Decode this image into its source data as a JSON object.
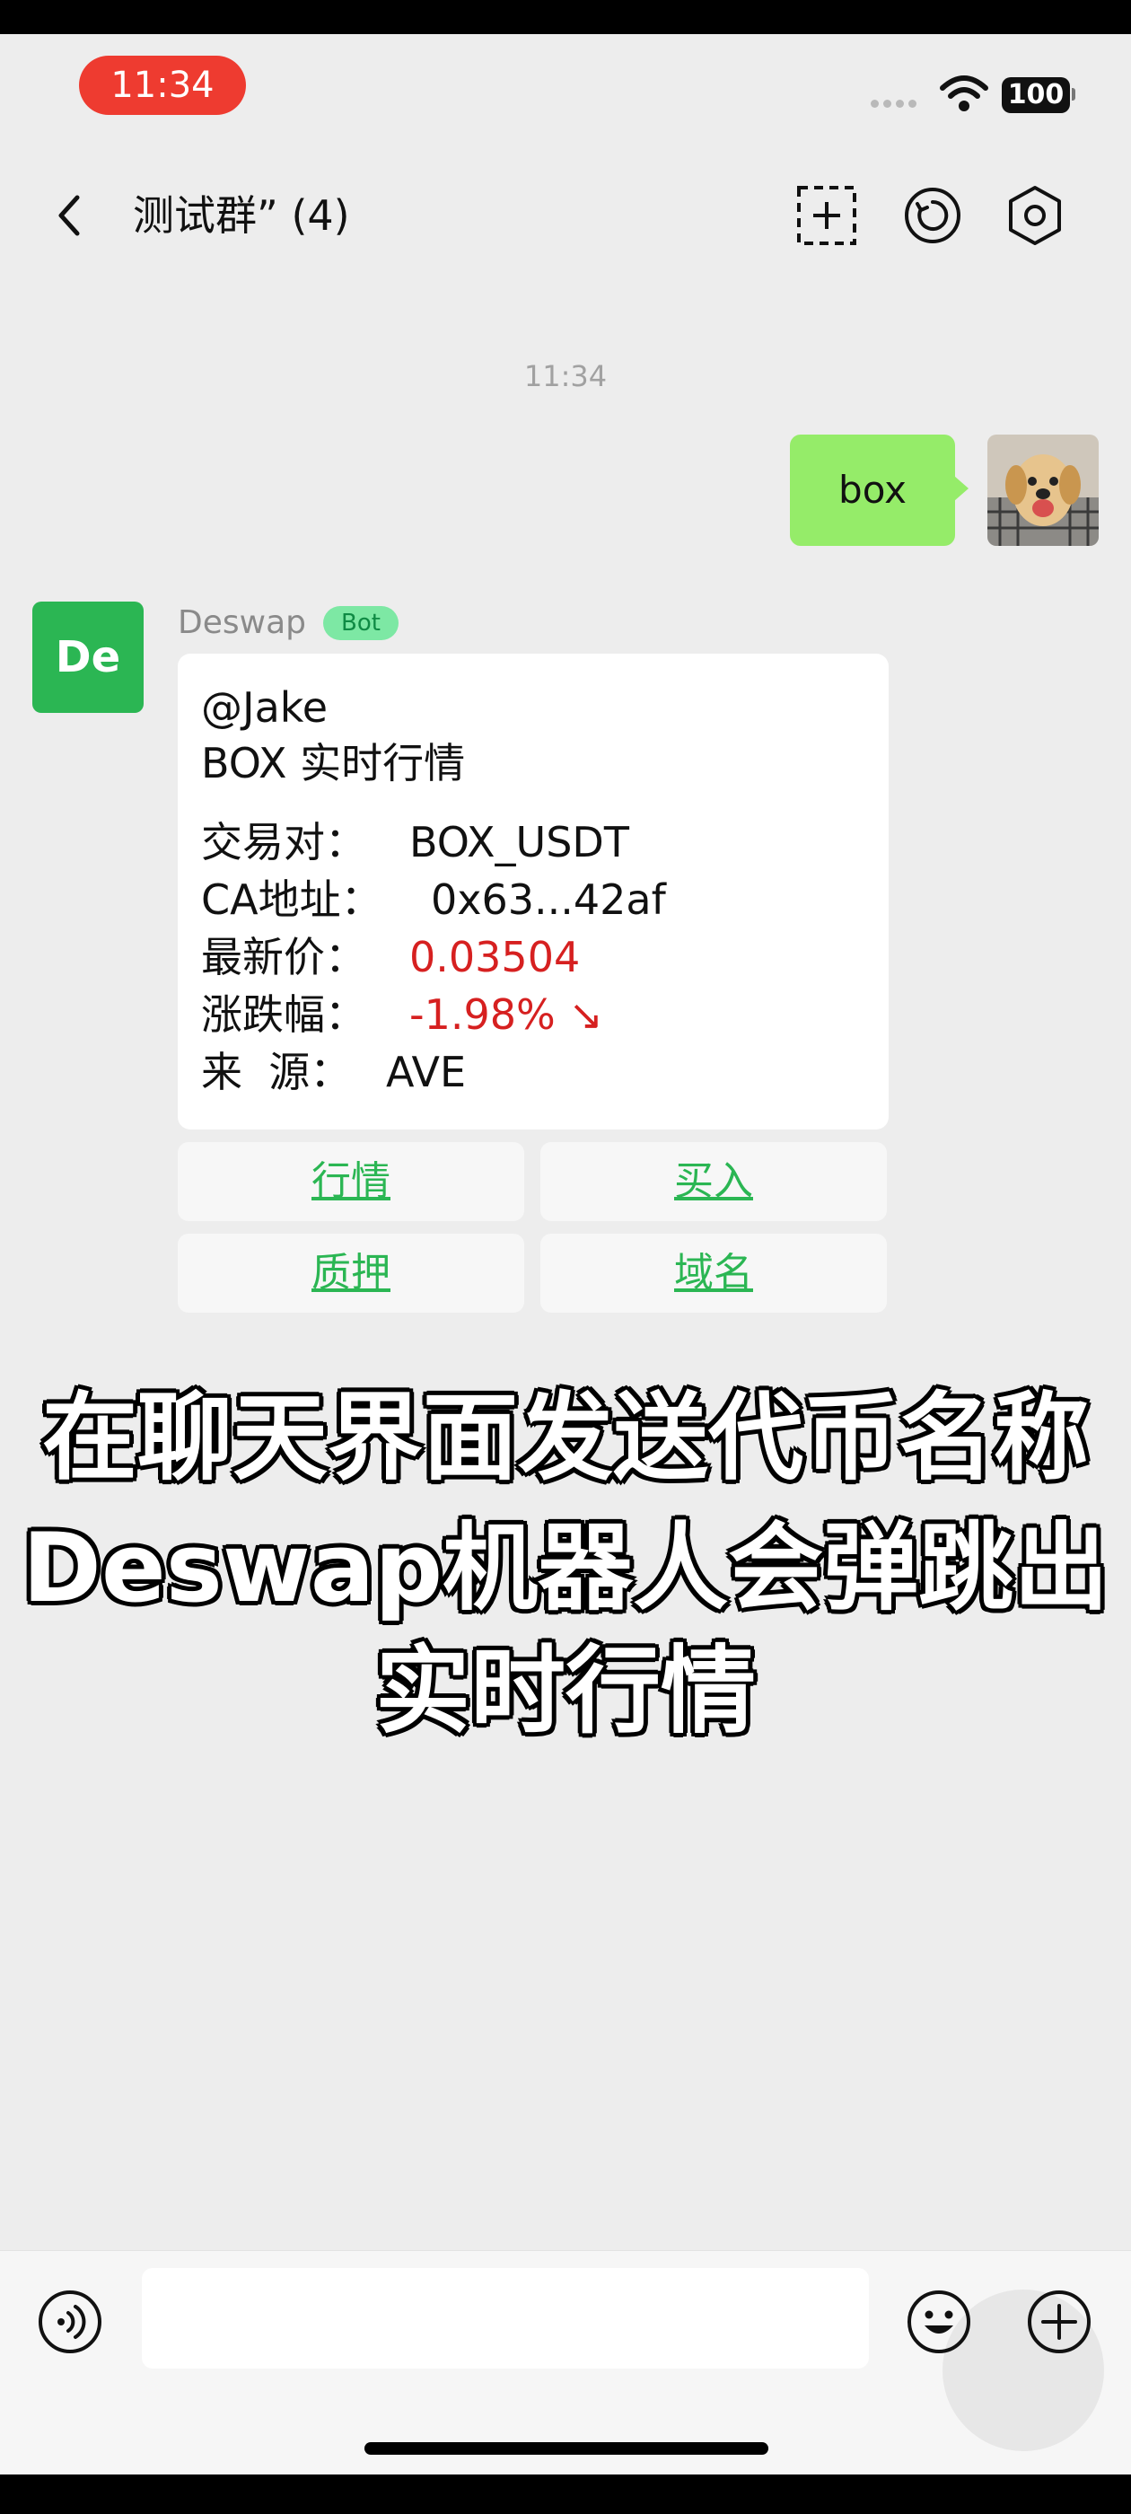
{
  "status_bar": {
    "time": "11:34",
    "battery": "100"
  },
  "nav": {
    "title": "测试群” (4)"
  },
  "chat": {
    "timestamp": "11:34",
    "outgoing": {
      "text": "box"
    },
    "bot": {
      "avatar_text": "De",
      "name": "Deswap",
      "badge": "Bot",
      "mention": "@Jake",
      "heading": "BOX 实时行情",
      "rows": [
        {
          "label": "交易对：",
          "value": "BOX_USDT"
        },
        {
          "label": "CA地址：",
          "value": "0x63...42af"
        },
        {
          "label": "最新价：",
          "value": "0.03504"
        },
        {
          "label": "涨跌幅：",
          "value": "-1.98% ↘"
        },
        {
          "label": "来  源：",
          "value": "AVE"
        }
      ],
      "buttons": [
        "行情",
        "买入",
        "质押",
        "域名"
      ]
    }
  },
  "caption": {
    "lines": [
      "在聊天界面发送代币名称",
      "Deswap机器人会弹跳出",
      "实时行情"
    ]
  },
  "colors": {
    "bubble_out": "#95ec69",
    "bot_green": "#2bb653",
    "price_red": "#d62020",
    "pill_red": "#ee3b30"
  },
  "icons": [
    "chevron-left-icon",
    "add-member-icon",
    "clock-icon",
    "settings-icon",
    "voice-icon",
    "emoji-icon",
    "plus-icon"
  ]
}
